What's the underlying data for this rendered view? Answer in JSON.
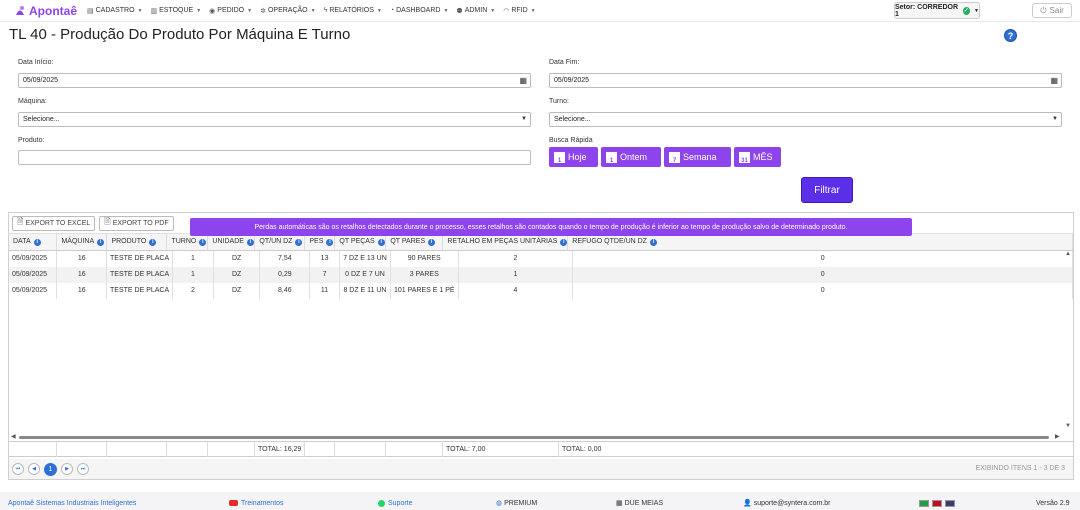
{
  "app": {
    "name": "Apontaê"
  },
  "nav": {
    "items": [
      {
        "icon": "list-icon",
        "label": "CADASTRO"
      },
      {
        "icon": "chart-icon",
        "label": "ESTOQUE"
      },
      {
        "icon": "eye-icon",
        "label": "PEDIDO"
      },
      {
        "icon": "cogs-icon",
        "label": "OPERAÇÃO"
      },
      {
        "icon": "bolt-icon",
        "label": "RELATÓRIOS"
      },
      {
        "icon": "dashboard-icon",
        "label": "DASHBOARD"
      },
      {
        "icon": "users-icon",
        "label": "ADMIN"
      },
      {
        "icon": "rss-icon",
        "label": "RFID"
      }
    ],
    "setor_label": "Setor: CORREDOR 1",
    "sair_label": "Sair"
  },
  "page": {
    "title": "TL 40 - Produção Do Produto Por Máquina E Turno",
    "help": "?"
  },
  "filters": {
    "data_inicio_label": "Data Início:",
    "data_inicio_value": "05/09/2025",
    "data_fim_label": "Data Fim:",
    "data_fim_value": "05/09/2025",
    "maquina_label": "Máquina:",
    "maquina_value": "Selecione...",
    "turno_label": "Turno:",
    "turno_value": "Selecione...",
    "produto_label": "Produto:",
    "produto_value": "",
    "busca_label": "Busca Rápida",
    "quick": [
      {
        "label": "Hoje",
        "day": "1"
      },
      {
        "label": "Ontem",
        "day": "1"
      },
      {
        "label": "Semana",
        "day": "7"
      },
      {
        "label": "MÊS",
        "day": "31"
      }
    ],
    "filtrar_label": "Filtrar"
  },
  "grid": {
    "export_excel": "EXPORT TO EXCEL",
    "export_pdf": "EXPORT TO PDF",
    "tooltip": "Perdas automáticas são os retalhos detectados durante o processo, esses retalhos são contados quando o tempo de produção é inferior ao tempo de produção salvo de determinado produto.",
    "columns": [
      "DATA",
      "MÁQUINA",
      "PRODUTO",
      "TURNO",
      "UNIDADE",
      "QT/UN DZ",
      "PES",
      "QT PEÇAS",
      "QT PARES",
      "RETALHO EM PEÇAS UNITÁRIAS",
      "REFUGO QTDE/UN DZ"
    ],
    "rows": [
      [
        "05/09/2025",
        "16",
        "TESTE DE PLACA",
        "1",
        "DZ",
        "7,54",
        "13",
        "7 DZ E 13 UN",
        "90 PARES",
        "2",
        "0"
      ],
      [
        "05/09/2025",
        "16",
        "TESTE DE PLACA",
        "1",
        "DZ",
        "0,29",
        "7",
        "0 DZ E 7 UN",
        "3 PARES",
        "1",
        "0"
      ],
      [
        "05/09/2025",
        "16",
        "TESTE DE PLACA",
        "2",
        "DZ",
        "8,46",
        "11",
        "8 DZ E 11 UN",
        "101 PARES E 1 PÉ",
        "4",
        "0"
      ]
    ],
    "totals": {
      "qt_un": "TOTAL: 16,29",
      "retalho": "TOTAL: 7,00",
      "refugo": "TOTAL: 0,00"
    },
    "page_current": "1",
    "exibindo": "EXIBINDO ITENS 1 - 3 DE 3"
  },
  "footer": {
    "company": "Apontaê Sistemas Industriais Inteligentes",
    "treinamentos": "Treinamentos",
    "suporte": "Suporte",
    "premium": "PREMIUM",
    "client": "DUE MEIAS",
    "email": "suporte@syntera.com.br",
    "versao": "Versão 2.9"
  }
}
